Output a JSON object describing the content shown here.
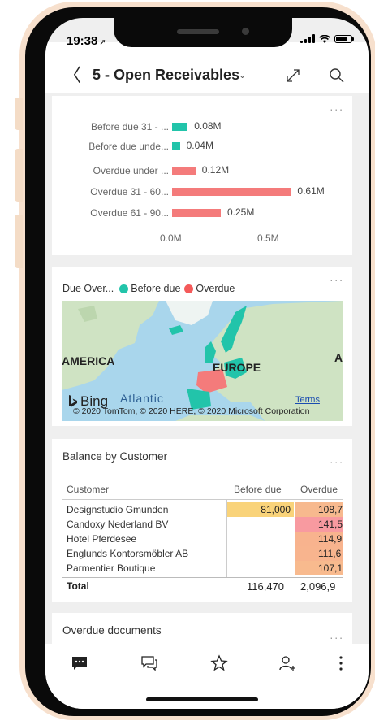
{
  "status": {
    "time": "19:38"
  },
  "header": {
    "title": "5 - Open Receivables"
  },
  "chart1": {
    "more": "...",
    "axis_ticks": [
      "0.0M",
      "0.5M"
    ]
  },
  "chart_data": [
    {
      "type": "bar",
      "orientation": "horizontal",
      "categories": [
        "Before due 31 - ...",
        "Before due unde...",
        "Overdue under ...",
        "Overdue 31 - 60...",
        "Overdue 61 - 90..."
      ],
      "values": [
        0.08,
        0.04,
        0.12,
        0.61,
        0.25
      ],
      "value_labels": [
        "0.08M",
        "0.04M",
        "0.12M",
        "0.61M",
        "0.25M"
      ],
      "colors": [
        "#22c4aa",
        "#22c4aa",
        "#f47b7b",
        "#f47b7b",
        "#f47b7b"
      ],
      "xlim": [
        0,
        0.65
      ],
      "axis_ticks": [
        "0.0M",
        "0.5M"
      ],
      "grid": false
    }
  ],
  "map": {
    "title": "Due Over...",
    "legend": [
      {
        "label": "Before due",
        "color": "#22c4aa"
      },
      {
        "label": "Overdue",
        "color": "#f45a5a"
      }
    ],
    "labels": {
      "america": "AMERICA",
      "europe": "EUROPE",
      "a": "A",
      "atlantic": "Atlantic"
    },
    "bing": "Bing",
    "terms": "Terms",
    "copyright": "© 2020 TomTom, © 2020 HERE, © 2020 Microsoft Corporation",
    "more": "..."
  },
  "table": {
    "title": "Balance by Customer",
    "more": "...",
    "headers": [
      "Customer",
      "Before due",
      "Overdue"
    ],
    "rows": [
      {
        "customer": "Designstudio Gmunden",
        "before": "81,000",
        "overdue": "108,7",
        "overdue_color": "#f7b98e"
      },
      {
        "customer": "Candoxy Nederland BV",
        "before": "",
        "overdue": "141,5",
        "overdue_color": "#f89aa0"
      },
      {
        "customer": "Hotel Pferdesee",
        "before": "",
        "overdue": "114,9",
        "overdue_color": "#f8b38e"
      },
      {
        "customer": "Englunds Kontorsmöbler AB",
        "before": "",
        "overdue": "111,6",
        "overdue_color": "#f8b48e"
      },
      {
        "customer": "Parmentier Boutique",
        "before": "",
        "overdue": "107,1",
        "overdue_color": "#f8ba8e"
      }
    ],
    "total": {
      "label": "Total",
      "before": "116,470",
      "overdue": "2,096,9"
    },
    "before_color": "#f9d37a"
  },
  "overdue": {
    "title": "Overdue documents",
    "more": "..."
  },
  "nav": {
    "items": [
      "chat-icon",
      "comments-icon",
      "star-icon",
      "person-add-icon",
      "more-vertical-icon"
    ]
  }
}
